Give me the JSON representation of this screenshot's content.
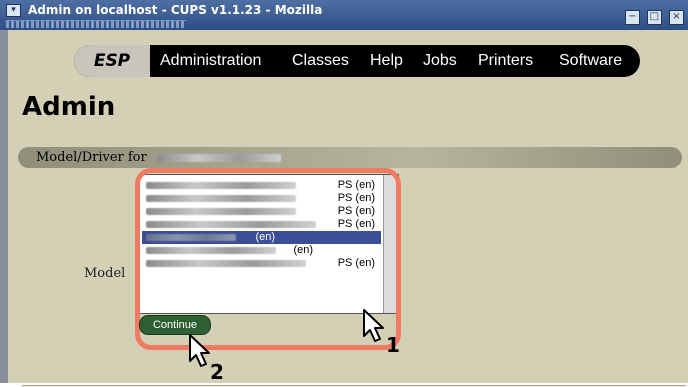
{
  "window": {
    "title": "Admin on localhost - CUPS v1.1.23 - Mozilla",
    "minimize_glyph": "−",
    "maximize_glyph": "□",
    "close_glyph": "×"
  },
  "nav": {
    "items": [
      {
        "label": "ESP"
      },
      {
        "label": "Administration"
      },
      {
        "label": "Classes"
      },
      {
        "label": "Help"
      },
      {
        "label": "Jobs"
      },
      {
        "label": "Printers"
      },
      {
        "label": "Software"
      }
    ]
  },
  "page": {
    "title": "Admin",
    "section_label": "Model/Driver for"
  },
  "form": {
    "model_label": "Model",
    "continue_label": "Continue",
    "model_options": [
      {
        "suffix": "PS (en)",
        "selected": false
      },
      {
        "suffix": "PS (en)",
        "selected": false
      },
      {
        "suffix": "PS (en)",
        "selected": false
      },
      {
        "suffix": "PS (en)",
        "selected": false
      },
      {
        "suffix": "(en)",
        "selected": true
      },
      {
        "suffix": "(en)",
        "selected": false
      },
      {
        "suffix": "PS (en)",
        "selected": false
      }
    ]
  },
  "annotations": {
    "callout_1": "1",
    "callout_2": "2",
    "highlight_color": "#f07b62"
  },
  "colors": {
    "page_background": "#d4d0b6",
    "nav_background": "#000000",
    "selected_option": "#3c4f96",
    "continue_button": "#2e5f33"
  }
}
